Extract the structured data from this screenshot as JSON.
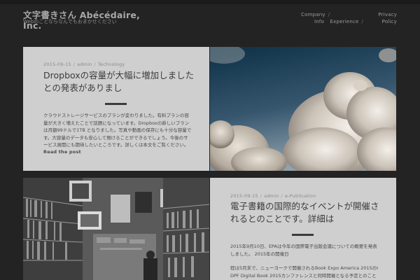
{
  "site": {
    "title": "文字書きさん Abécédaire, Inc.",
    "tagline": "Webのことならなんでもおまかせください"
  },
  "nav": {
    "left_row1": "Company",
    "left_row2_a": "Info",
    "left_row2_b": "Experience",
    "right_row1": "Privacy",
    "right_row2": "Policy",
    "sep": "/"
  },
  "posts": [
    {
      "date": "2015-09-15",
      "author": "admin",
      "category": "Technology",
      "title": "Dropboxの容量が大幅に増加しましたとの発表がありまし",
      "excerpt": "クラウドストレージサービスのプランが変わりました。有料プランの容量が大きく増えたことで話題になっています。Dropboxの新しいプランは月額99ドルで1TB となりました。写真や動画の保存にも十分な容量です。大容量のデータも安心して預けることができるでしょう。今後のサービス展開にも期待したいところです。詳しくは本文をご覧ください。",
      "read_more": "Read the post"
    },
    {
      "date": "2015-09-15",
      "author": "admin",
      "category": "e-Publication",
      "title": "電子書籍の国際的なイベントが開催されるとのことです。詳細は",
      "excerpt_p1": "2015年9月10日、EPAは今年の国際電子出版会議についての概要を発表しました。 2015年の開催日",
      "excerpt_p2": "程は5月末で、ニューヨークで開催されるBook Expo America 2015のIDPF Digital Book 2015カンファレンスと同時開催となる予定とのことです。"
    }
  ],
  "meta_sep": "/"
}
